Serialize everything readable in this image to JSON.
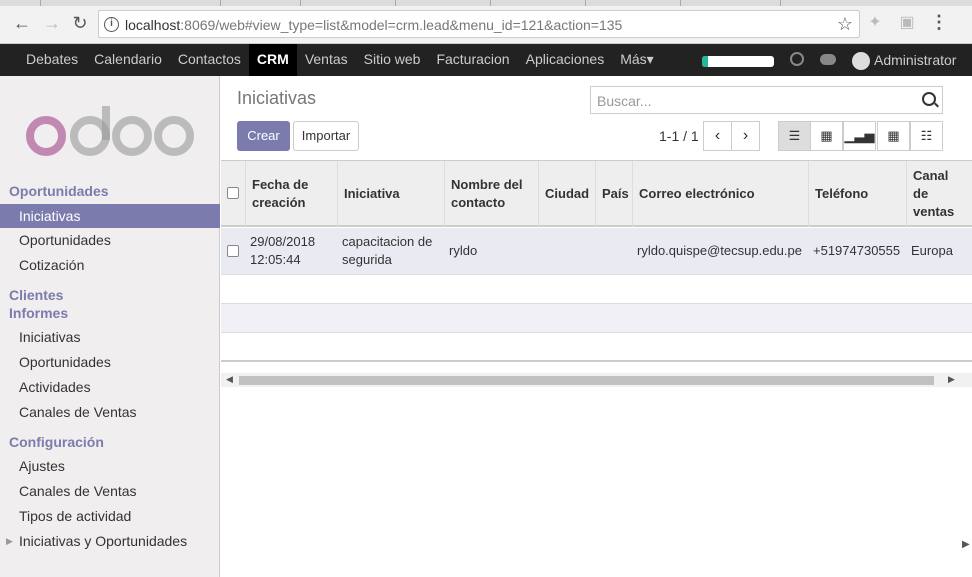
{
  "browser": {
    "url_host": "localhost",
    "url_rest": ":8069/web#view_type=list&model=crm.lead&menu_id=121&action=135"
  },
  "topbar": {
    "menu": [
      "Debates",
      "Calendario",
      "Contactos",
      "CRM",
      "Ventas",
      "Sitio web",
      "Facturacion",
      "Aplicaciones",
      "Más▾"
    ],
    "active_index": 3,
    "progress": 0.08,
    "user": "Administrator"
  },
  "sidebar": {
    "logo_text": "odoo",
    "section1": "Oportunidades",
    "items1": [
      "Iniciativas",
      "Oportunidades",
      "Cotización"
    ],
    "section2": "Clientes",
    "section3": "Informes",
    "items3": [
      "Iniciativas",
      "Oportunidades",
      "Actividades",
      "Canales de Ventas"
    ],
    "section4": "Configuración",
    "items4": [
      "Ajustes",
      "Canales de Ventas",
      "Tipos de actividad",
      "Iniciativas y Oportunidades"
    ]
  },
  "control": {
    "breadcrumb": "Iniciativas",
    "search_placeholder": "Buscar...",
    "create": "Crear",
    "import": "Importar",
    "pager": "1-1 / 1"
  },
  "table": {
    "headers": [
      "Fecha de creación",
      "Iniciativa",
      "Nombre del contacto",
      "Ciudad",
      "País",
      "Correo electrónico",
      "Teléfono",
      "Canal de ventas"
    ],
    "rows": [
      [
        "29/08/2018 12:05:44",
        "capacitacion de segurida",
        "ryldo",
        "",
        "",
        "ryldo.quispe@tecsup.edu.pe",
        "+51974730555",
        "Europa"
      ]
    ]
  },
  "colors": {
    "accent": "#7c7bad",
    "topbar": "#222222"
  }
}
